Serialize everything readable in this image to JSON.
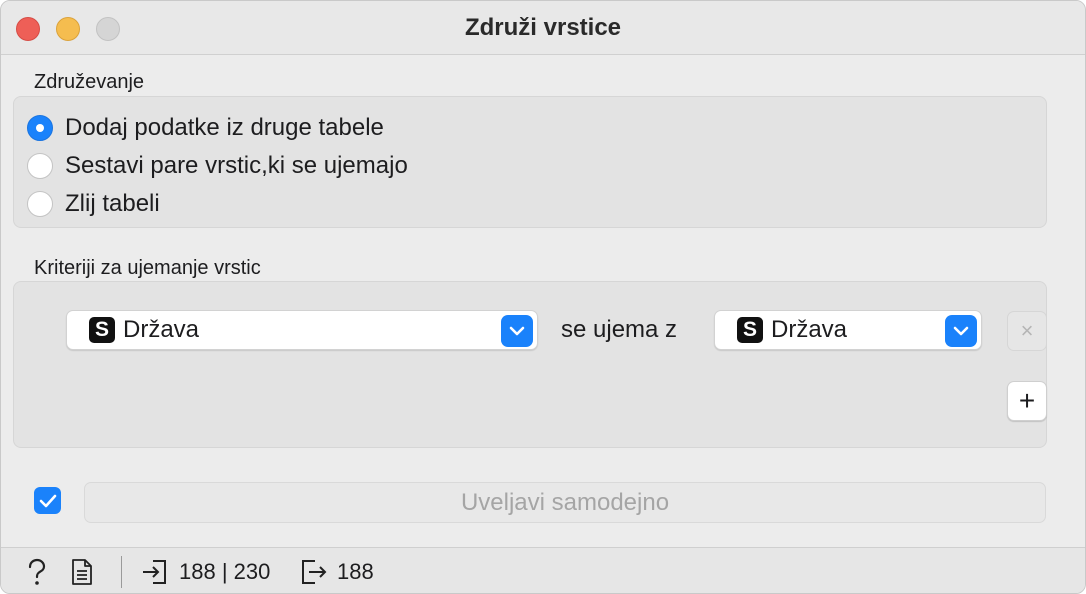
{
  "window": {
    "title": "Združi vrstice"
  },
  "merging": {
    "label": "Združevanje",
    "options": [
      {
        "label": "Dodaj podatke iz druge tabele",
        "selected": true
      },
      {
        "label": "Sestavi pare vrstic,ki se ujemajo",
        "selected": false
      },
      {
        "label": "Zlij tabeli",
        "selected": false
      }
    ]
  },
  "criteria": {
    "label": "Kriteriji za ujemanje vrstic",
    "rows": [
      {
        "left": {
          "badge": "S",
          "value": "Država"
        },
        "connector": "se ujema z",
        "right": {
          "badge": "S",
          "value": "Država"
        },
        "remove_label": "×"
      }
    ],
    "add_label": "+"
  },
  "footer": {
    "auto_apply_checked": true,
    "apply_label": "Uveljavi samodejno"
  },
  "statusbar": {
    "input_counts": "188 | 230",
    "output_count": "188"
  },
  "colors": {
    "accent": "#1a82fb",
    "close": "#ee5f57",
    "minimize": "#f5bd4f",
    "maximize": "#d5d5d5"
  },
  "icons": [
    "help-icon",
    "report-icon",
    "input-icon",
    "output-icon",
    "chevron-down-icon",
    "checkmark-icon"
  ]
}
